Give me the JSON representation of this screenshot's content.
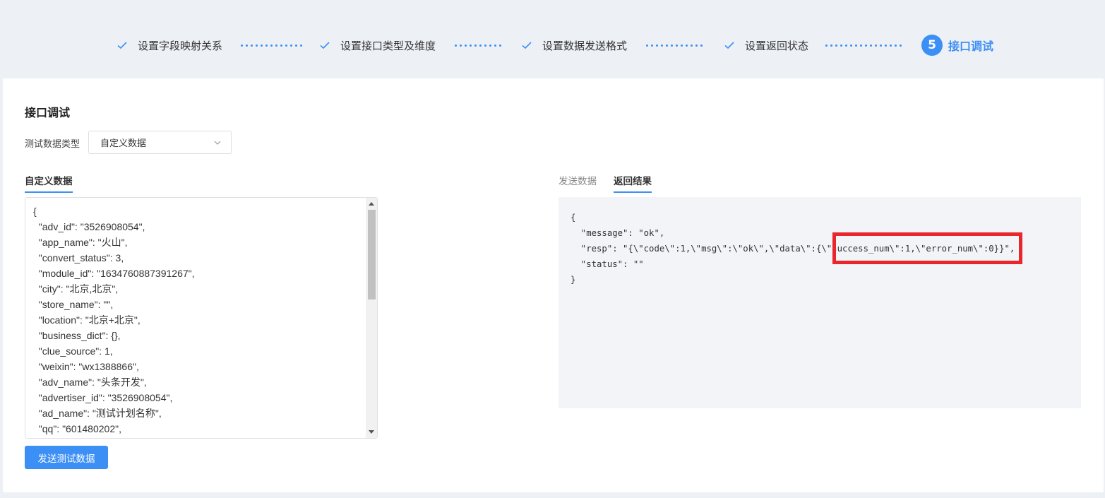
{
  "steps": [
    {
      "label": "设置字段映射关系",
      "status": "done",
      "icon": "check-icon"
    },
    {
      "label": "设置接口类型及维度",
      "status": "done",
      "icon": "check-icon"
    },
    {
      "label": "设置数据发送格式",
      "status": "done",
      "icon": "check-icon"
    },
    {
      "label": "设置返回状态",
      "status": "done",
      "icon": "check-icon"
    },
    {
      "number": "5",
      "label": "接口调试",
      "status": "active"
    }
  ],
  "page": {
    "title": "接口调试",
    "test_type_label": "测试数据类型",
    "test_type_value": "自定义数据"
  },
  "left_tab": "自定义数据",
  "right_tabs": [
    {
      "label": "发送数据",
      "active": false
    },
    {
      "label": "返回结果",
      "active": true
    }
  ],
  "custom_data_text": "{\n  \"adv_id\": \"3526908054\",\n  \"app_name\": \"火山\",\n  \"convert_status\": 3,\n  \"module_id\": \"1634760887391267\",\n  \"city\": \"北京,北京\",\n  \"store_name\": \"\",\n  \"location\": \"北京+北京\",\n  \"business_dict\": {},\n  \"clue_source\": 1,\n  \"weixin\": \"wx1388866\",\n  \"adv_name\": \"头条开发\",\n  \"advertiser_id\": \"3526908054\",\n  \"ad_name\": \"测试计划名称\",\n  \"qq\": \"601480202\",",
  "result_text": "{\n  \"message\": \"ok\",\n  \"resp\": \"{\\\"code\\\":1,\\\"msg\\\":\\\"ok\\\",\\\"data\\\":{\\\"success_num\\\":1,\\\"error_num\\\":0}}\",\n  \"status\": \"\"\n}",
  "send_button": "发送测试数据",
  "colors": {
    "accent": "#3b8ff5",
    "highlight": "#e8262c",
    "background": "#edf0f5"
  }
}
